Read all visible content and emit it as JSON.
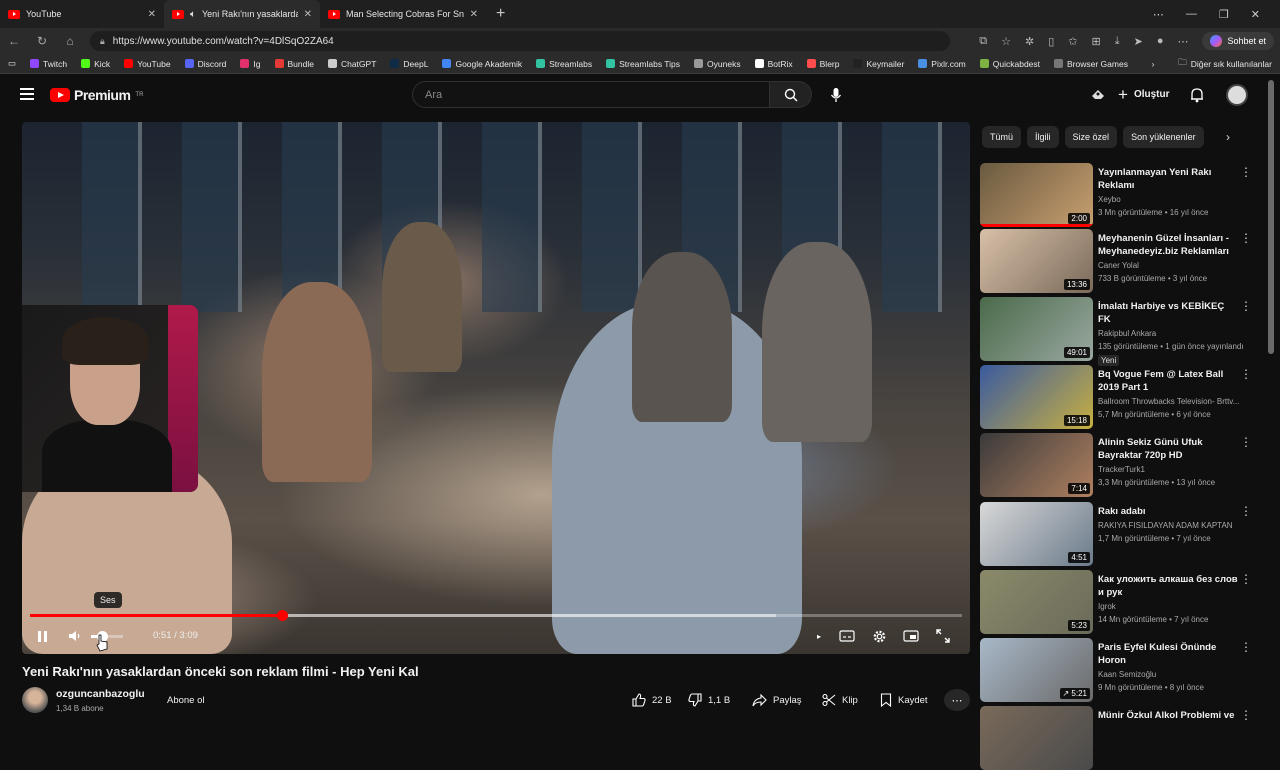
{
  "browser": {
    "tabs": [
      {
        "label": "YouTube",
        "active": false
      },
      {
        "label": "Yeni Rakı'nın yasaklardan önceki",
        "active": true
      },
      {
        "label": "Man Selecting Cobras For Snake S",
        "active": false
      }
    ],
    "new_tab": "+",
    "url": "https://www.youtube.com/watch?v=4DlSqO2ZA64",
    "copilot_label": "Sohbet et",
    "bookmarks": [
      {
        "label": "Twitch",
        "color": "#9146ff"
      },
      {
        "label": "Kick",
        "color": "#53fc18"
      },
      {
        "label": "YouTube",
        "color": "#ff0000"
      },
      {
        "label": "Discord",
        "color": "#5865f2"
      },
      {
        "label": "Ig",
        "color": "#e1306c"
      },
      {
        "label": "Bundle",
        "color": "#e53935"
      },
      {
        "label": "ChatGPT",
        "color": "#cccccc"
      },
      {
        "label": "DeepL",
        "color": "#0f2b46"
      },
      {
        "label": "Google Akademik",
        "color": "#4285f4"
      },
      {
        "label": "Streamlabs",
        "color": "#31c3a2"
      },
      {
        "label": "Streamlabs Tips",
        "color": "#31c3a2"
      },
      {
        "label": "Oyuneks",
        "color": "#999999"
      },
      {
        "label": "BotRix",
        "color": "#ffffff"
      },
      {
        "label": "Blerp",
        "color": "#ff4d4d"
      },
      {
        "label": "Keymailer",
        "color": "#222222"
      },
      {
        "label": "Pixlr.com",
        "color": "#4a90e2"
      },
      {
        "label": "Quickabdest",
        "color": "#7cb342"
      },
      {
        "label": "Browser Games",
        "color": "#777777"
      }
    ],
    "bookmarks_more": "Diğer sık kullanılanlar"
  },
  "youtube": {
    "logo_text": "Premium",
    "logo_region": "TR",
    "search_placeholder": "Ara",
    "create_label": "Oluştur"
  },
  "player": {
    "tooltip": "Ses",
    "current_time": "0:51",
    "duration": "3:09",
    "time_display": "0:51 / 3:09",
    "progress_fraction": 0.27,
    "buffer_fraction": 0.8,
    "volume_fraction": 0.35
  },
  "video": {
    "title": "Yeni Rakı'nın yasaklardan önceki son reklam filmi - Hep Yeni Kal",
    "channel": "ozguncanbazoglu",
    "subscribers": "1,34 B abone",
    "subscribe_label": "Abone ol",
    "likes": "22 B",
    "dislikes": "1,1 B",
    "share_label": "Paylaş",
    "clip_label": "Klip",
    "save_label": "Kaydet"
  },
  "chips": [
    "Tümü",
    "İlgili",
    "Size özel",
    "Son yüklenenler"
  ],
  "recommendations": [
    {
      "title": "Yayınlanmayan Yeni Rakı Reklamı",
      "channel": "Xeybo",
      "meta": "3 Mn görüntüleme • 16 yıl önce",
      "duration": "2:00",
      "watched": 1.0,
      "colors": [
        "#6a5a40",
        "#c9a070"
      ]
    },
    {
      "title": "Meyhanenin Güzel İnsanları - Meyhanedeyiz.biz Reklamları",
      "channel": "Caner Yolal",
      "meta": "733 B görüntüleme • 3 yıl önce",
      "duration": "13:36",
      "colors": [
        "#d8c0a8",
        "#7a6a5a"
      ]
    },
    {
      "title": "İmalatı Harbiye vs KEBİKEÇ FK",
      "channel": "Rakipbul Ankara",
      "meta": "135 görüntüleme • 1 gün önce yayınlandı",
      "badge": "Yeni",
      "duration": "49:01",
      "colors": [
        "#4a6a4a",
        "#9aa8a0"
      ]
    },
    {
      "title": "Bq Vogue Fem @ Latex Ball 2019 Part 1",
      "channel": "Ballroom Throwbacks Television- Brttv...",
      "meta": "5,7 Mn görüntüleme • 6 yıl önce",
      "duration": "15:18",
      "colors": [
        "#3a5aa0",
        "#c8b040"
      ]
    },
    {
      "title": "Alinin Sekiz Günü Ufuk Bayraktar 720p HD",
      "channel": "TrackerTurk1",
      "meta": "3,3 Mn görüntüleme • 13 yıl önce",
      "duration": "7:14",
      "colors": [
        "#3a3a3a",
        "#b08060"
      ]
    },
    {
      "title": "Rakı adabı",
      "channel": "RAKIYA FISILDAYAN ADAM KAPTAN",
      "meta": "1,7 Mn görüntüleme • 7 yıl önce",
      "duration": "4:51",
      "colors": [
        "#d8d8d8",
        "#6a7a8a"
      ]
    },
    {
      "title": "Как уложить алкаша без слов и рук",
      "channel": "Igrok",
      "meta": "14 Mn görüntüleme • 7 yıl önce",
      "duration": "5:23",
      "colors": [
        "#8a8a6a",
        "#6a6a5a"
      ]
    },
    {
      "title": "Paris Eyfel Kulesi Önünde Horon",
      "channel": "Kaan Semizoğlu",
      "meta": "9 Mn görüntüleme • 8 yıl önce",
      "duration": "5:21",
      "shorts": true,
      "colors": [
        "#a8b8c8",
        "#6a6a6a"
      ]
    },
    {
      "title": "Münir Özkul Alkol Problemi ve",
      "channel": "",
      "meta": "",
      "duration": "",
      "colors": [
        "#7a6a5a",
        "#4a4a4a"
      ]
    }
  ]
}
